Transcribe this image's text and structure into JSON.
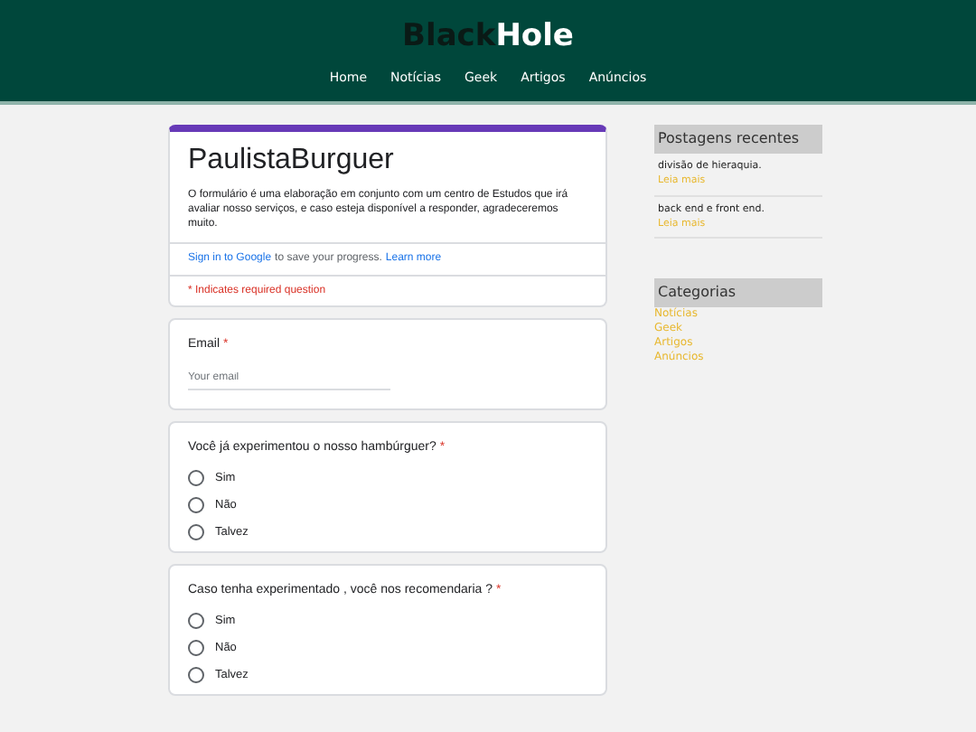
{
  "header": {
    "logo": {
      "dark": "Black",
      "light": "Hole"
    },
    "nav": [
      {
        "label": "Home"
      },
      {
        "label": "Notícias"
      },
      {
        "label": "Geek"
      },
      {
        "label": "Artigos"
      },
      {
        "label": "Anúncios"
      }
    ]
  },
  "form": {
    "title": "PaulistaBurguer",
    "description": "O formulário é uma elaboração em conjunto com um centro de Estudos que irá avaliar nosso serviços, e caso esteja disponível a responder, agradeceremos muito.",
    "signin": {
      "link": "Sign in to Google",
      "text": "to save your progress.",
      "learn_more": "Learn more"
    },
    "required_note": "* Indicates required question",
    "email": {
      "label": "Email",
      "asterisk": "*",
      "placeholder": "Your email"
    },
    "questions": [
      {
        "label": "Você já experimentou o nosso hambúrguer?",
        "asterisk": "*",
        "options": [
          {
            "label": "Sim",
            "selected": false
          },
          {
            "label": "Não",
            "selected": false
          },
          {
            "label": "Talvez",
            "selected": false
          }
        ]
      },
      {
        "label": "Caso tenha experimentado , você nos recomendaria ?",
        "asterisk": "*",
        "options": [
          {
            "label": "Sim",
            "selected": false
          },
          {
            "label": "Não",
            "selected": false
          },
          {
            "label": "Talvez",
            "selected": false
          }
        ]
      }
    ]
  },
  "sidebar": {
    "recent": {
      "title": "Postagens recentes",
      "posts": [
        {
          "title": "divisão de hieraquia.",
          "link": "Leia mais"
        },
        {
          "title": "back end e front end.",
          "link": "Leia mais"
        }
      ]
    },
    "categories": {
      "title": "Categorias",
      "items": [
        {
          "label": "Notícias"
        },
        {
          "label": "Geek"
        },
        {
          "label": "Artigos"
        },
        {
          "label": "Anúncios"
        }
      ]
    }
  }
}
